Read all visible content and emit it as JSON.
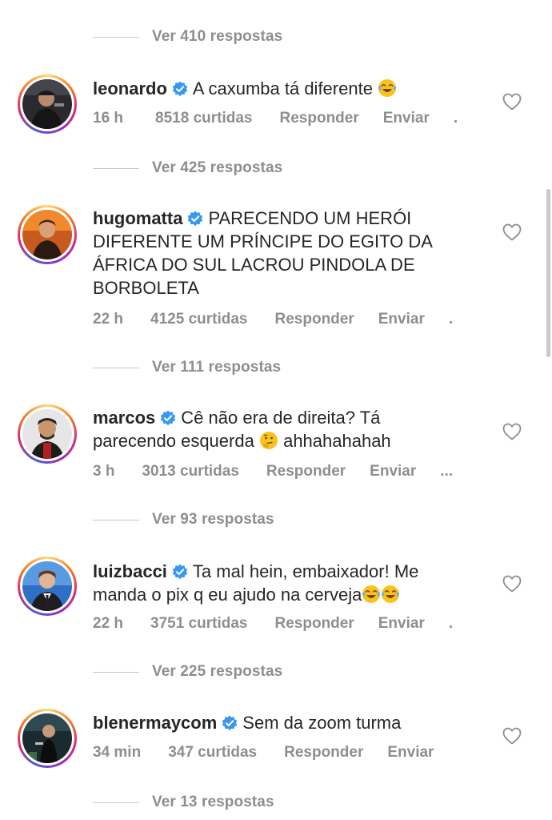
{
  "replies_top": "Ver 410 respostas",
  "comments": [
    {
      "username": "leonardo",
      "text": "A caxumba tá diferente",
      "emoji": "laughing-tears",
      "time": "16 h",
      "likes": "8518 curtidas",
      "reply": "Responder",
      "send": "Enviar",
      "more": ".",
      "replies": "Ver 425 respostas"
    },
    {
      "username": "hugomatta",
      "text": "PARECENDO UM HERÓI DIFERENTE UM PRÍNCIPE DO EGITO DA ÁFRICA DO SUL LACROU PINDOLA DE BORBOLETA",
      "time": "22 h",
      "likes": "4125 curtidas",
      "reply": "Responder",
      "send": "Enviar",
      "more": ".",
      "replies": "Ver 111 respostas"
    },
    {
      "username": "marcos",
      "text_a": "Cê não era de direita? Tá parecendo esquerda",
      "emoji": "thinking-face",
      "text_b": "ahhahahahah",
      "time": "3 h",
      "likes": "3013 curtidas",
      "reply": "Responder",
      "send": "Enviar",
      "more": "...",
      "replies": "Ver 93 respostas"
    },
    {
      "username": "luizbacci",
      "text": "Ta mal hein, embaixador! Me manda o pix q eu ajudo na cerveja",
      "emoji": "laughing-tears",
      "time": "22 h",
      "likes": "3751 curtidas",
      "reply": "Responder",
      "send": "Enviar",
      "more": ".",
      "replies": "Ver 225 respostas"
    },
    {
      "username": "blenermaycom",
      "text": "Sem da zoom turma",
      "time": "34 min",
      "likes": "347 curtidas",
      "reply": "Responder",
      "send": "Enviar",
      "replies": "Ver 13 respostas"
    }
  ],
  "colors": {
    "verified": "#3897f0",
    "muted": "#8e8e8e",
    "text": "#262626"
  }
}
